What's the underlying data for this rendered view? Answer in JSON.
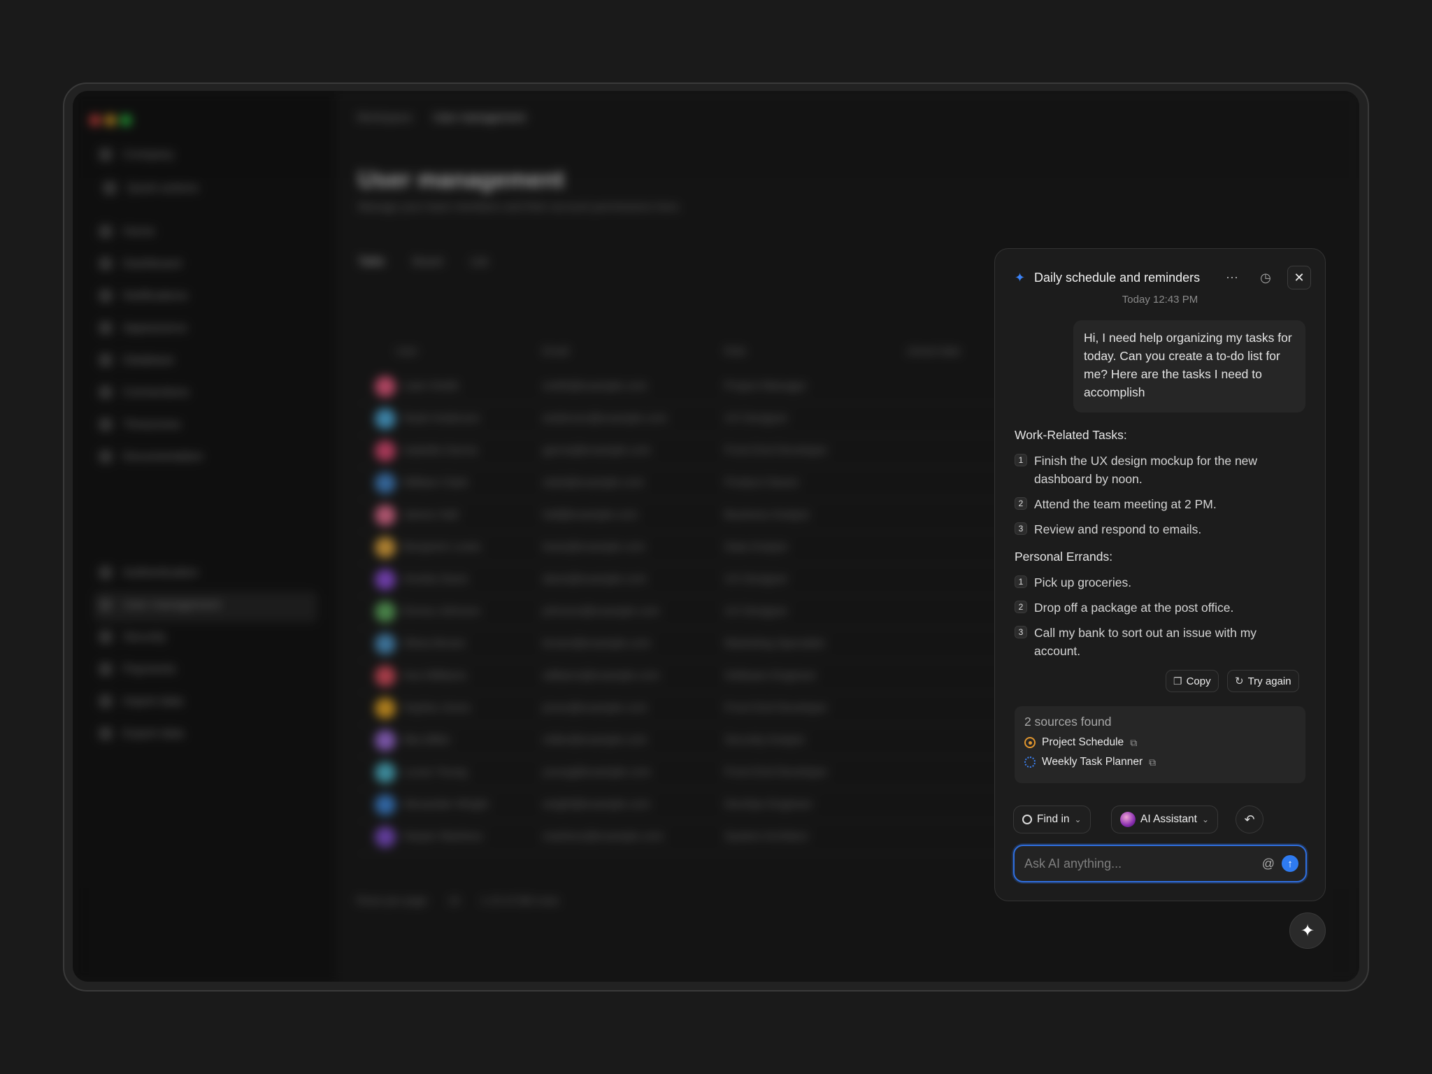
{
  "background_app": {
    "breadcrumb": [
      "Workspace",
      "User management"
    ],
    "page_title": "User management",
    "page_subtitle": "Manage your team members and their account permissions here.",
    "workspace": "Company",
    "quick_actions": "Quick actions",
    "sidebar_general": [
      "Home",
      "Dashboard",
      "Notifications",
      "Appearance",
      "Database",
      "Connections",
      "Timezones",
      "Documentation"
    ],
    "sidebar_settings": [
      "Authentication",
      "User management",
      "Security",
      "Payments",
      "Import data",
      "Export data"
    ],
    "view_tabs": [
      "Table",
      "Board",
      "List"
    ],
    "columns": [
      "User",
      "Email",
      "Role",
      "Joined date"
    ],
    "users": [
      {
        "name": "Liam Smith",
        "email": "smith@example.com",
        "role": "Project Manager",
        "color": "#e0557a"
      },
      {
        "name": "Noah Anderson",
        "email": "anderson@example.com",
        "role": "UX Designer",
        "color": "#4aa6d6"
      },
      {
        "name": "Isabella Garcia",
        "email": "garcia@example.com",
        "role": "Front End Developer",
        "color": "#d6456e"
      },
      {
        "name": "William Clark",
        "email": "clark@example.com",
        "role": "Product Owner",
        "color": "#3f7fc2"
      },
      {
        "name": "James Hall",
        "email": "hall@example.com",
        "role": "Business Analyst",
        "color": "#e06a8c"
      },
      {
        "name": "Benjamin Lewis",
        "email": "lewis@example.com",
        "role": "Data Analyst",
        "color": "#e0a43a"
      },
      {
        "name": "Amelia Davis",
        "email": "davis@example.com",
        "role": "UX Designer",
        "color": "#8a4ad6"
      },
      {
        "name": "Emma Johnson",
        "email": "johnson@example.com",
        "role": "UX Designer",
        "color": "#5aa65a"
      },
      {
        "name": "Olivia Brown",
        "email": "brown@example.com",
        "role": "Marketing Specialist",
        "color": "#4a90c2"
      },
      {
        "name": "Ava Williams",
        "email": "williams@example.com",
        "role": "Software Engineer",
        "color": "#d64a5a"
      },
      {
        "name": "Sophia Jones",
        "email": "jones@example.com",
        "role": "Front End Developer",
        "color": "#e0a020"
      },
      {
        "name": "Mia Miller",
        "email": "miller@example.com",
        "role": "Security Analyst",
        "color": "#9a6ad6"
      },
      {
        "name": "Lucas Young",
        "email": "young@example.com",
        "role": "Front End Developer",
        "color": "#4ab0c6"
      },
      {
        "name": "Alexander Wright",
        "email": "wright@example.com",
        "role": "DevOps Engineer",
        "color": "#3a80d0"
      },
      {
        "name": "Harper Martinez",
        "email": "martinez@example.com",
        "role": "System Architect",
        "color": "#7a4ac6"
      }
    ],
    "rows_per_page": "Rows per page",
    "page_size": "15",
    "row_range": "1-15 of 300 rows"
  },
  "assistant": {
    "title": "Daily schedule and reminders",
    "timestamp": "Today 12:43 PM",
    "user_message": "Hi, I need help organizing my tasks for today. Can you create a to-do list for me? Here are the tasks I need to accomplish",
    "sections": [
      {
        "heading": "Work-Related Tasks:",
        "items": [
          {
            "n": "1",
            "text": "Finish the UX design mockup for the new dashboard by noon."
          },
          {
            "n": "2",
            "text": "Attend the team meeting at 2 PM."
          },
          {
            "n": "3",
            "text": "Review and respond to emails."
          }
        ]
      },
      {
        "heading": "Personal Errands:",
        "items": [
          {
            "n": "1",
            "text": "Pick up groceries."
          },
          {
            "n": "2",
            "text": "Drop off a package at the post office."
          },
          {
            "n": "3",
            "text": "Call my bank to sort out an issue with my account."
          }
        ]
      }
    ],
    "copy_label": "Copy",
    "try_again_label": "Try again",
    "sources_heading": "2 sources found",
    "sources": [
      {
        "name": "Project Schedule",
        "icon": "sun-icon",
        "color": "#e0952e"
      },
      {
        "name": "Weekly Task Planner",
        "icon": "dotted-circle-icon",
        "color": "#3b82f6"
      }
    ],
    "find_in_label": "Find in",
    "model_label": "AI Assistant",
    "input_placeholder": "Ask AI anything...",
    "accent_color": "#2f7bf0"
  }
}
